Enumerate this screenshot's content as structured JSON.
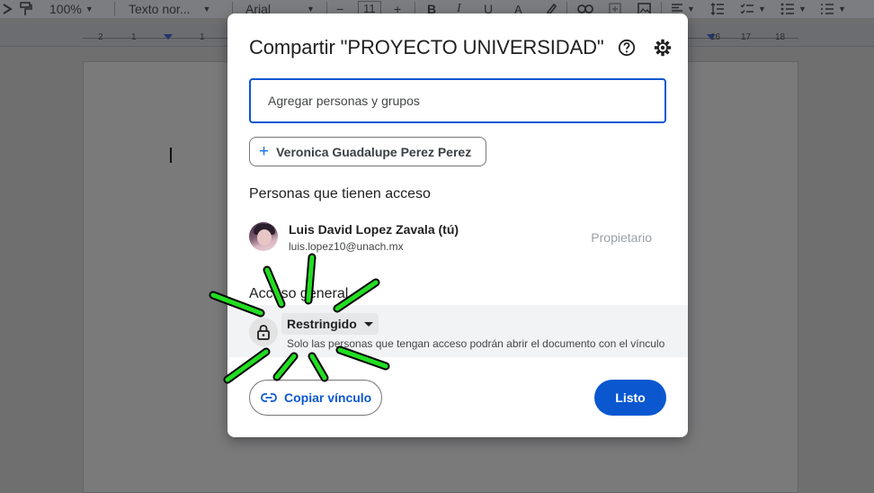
{
  "toolbar": {
    "zoom": "100%",
    "style": "Texto nor...",
    "font": "Arial",
    "font_size": "11",
    "minus": "−",
    "plus": "+",
    "bold": "B",
    "italic": "I",
    "underline": "U",
    "text_color": "A",
    "icons": [
      "paint-format-icon",
      "highlighter-icon",
      "link-icon",
      "comment-icon",
      "image-icon",
      "align-icon",
      "line-spacing-icon",
      "checklist-icon",
      "bullet-list-icon",
      "numbered-list-icon"
    ]
  },
  "ruler": {
    "left_numbers": [
      "2",
      "1",
      "1"
    ],
    "right_numbers": [
      "16",
      "17",
      "18"
    ]
  },
  "dialog": {
    "title": "Compartir \"PROYECTO UNIVERSIDAD\"",
    "add_placeholder": "Agregar personas y grupos",
    "suggestion": "Veronica Guadalupe Perez Perez",
    "access_heading": "Personas que tienen acceso",
    "owner": {
      "name": "Luis David Lopez Zavala (tú)",
      "email": "luis.lopez10@unach.mx",
      "role": "Propietario"
    },
    "general_heading": "Acceso general",
    "general_access": {
      "selected": "Restringido",
      "description": "Solo las personas que tengan acceso podrán abrir el documento con el vínculo"
    },
    "copy_link": "Copiar vínculo",
    "done": "Listo"
  },
  "colors": {
    "accent": "#0b57d0",
    "highlight": "#22dd22"
  }
}
